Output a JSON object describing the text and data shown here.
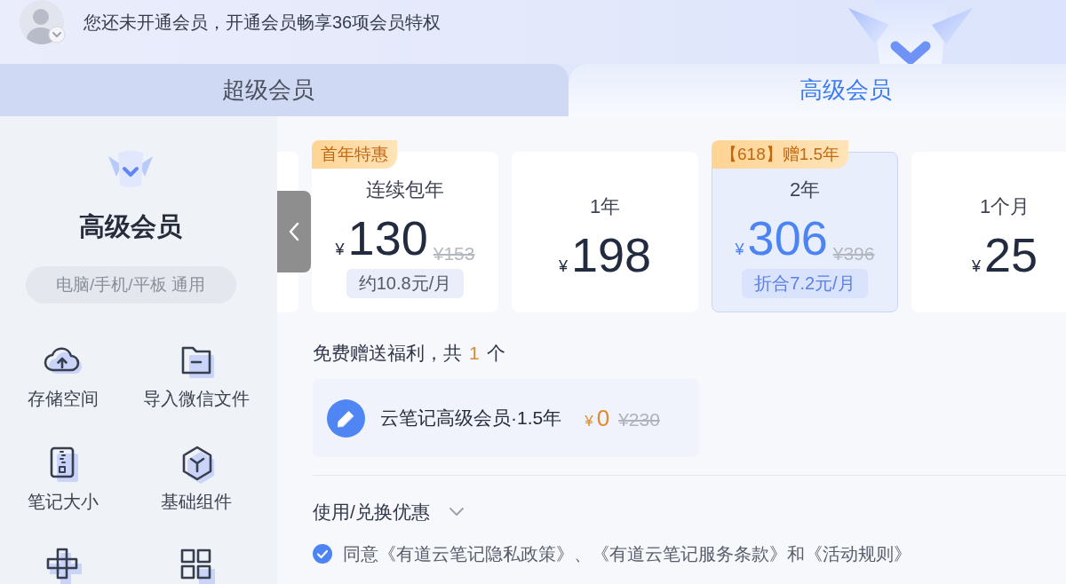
{
  "header": {
    "notice": "您还未开通会员，开通会员畅享36项会员特权"
  },
  "tabs": [
    {
      "label": "超级会员",
      "selected": false
    },
    {
      "label": "高级会员",
      "selected": true
    }
  ],
  "sidebar": {
    "title": "高级会员",
    "platforms": "电脑/手机/平板 通用",
    "features": [
      {
        "label": "存储空间"
      },
      {
        "label": "导入微信文件"
      },
      {
        "label": "笔记大小"
      },
      {
        "label": "基础组件"
      }
    ]
  },
  "plans": [
    {
      "badge": "首年特惠",
      "name": "连续包年",
      "currency": "¥",
      "price": "130",
      "original_price": "¥153",
      "note": "约10.8元/月",
      "selected": false
    },
    {
      "name": "1年",
      "currency": "¥",
      "price": "198",
      "selected": false
    },
    {
      "badge": "【618】赠1.5年",
      "name": "2年",
      "currency": "¥",
      "price": "306",
      "original_price": "¥396",
      "note": "折合7.2元/月",
      "selected": true
    },
    {
      "name": "1个月",
      "currency": "¥",
      "price": "25",
      "selected": false
    }
  ],
  "gifts": {
    "title": "免费赠送福利，共",
    "count": "1",
    "unit": "个",
    "items": [
      {
        "name": "云笔记高级会员·1.5年",
        "currency": "¥",
        "price": "0",
        "original_price": "¥230"
      }
    ]
  },
  "coupon": {
    "label": "使用/兑换优惠",
    "expanded": false
  },
  "agreement": {
    "checked": true,
    "text": "同意《有道云笔记隐私政策》、《有道云笔记服务条款》和《活动规则》"
  }
}
